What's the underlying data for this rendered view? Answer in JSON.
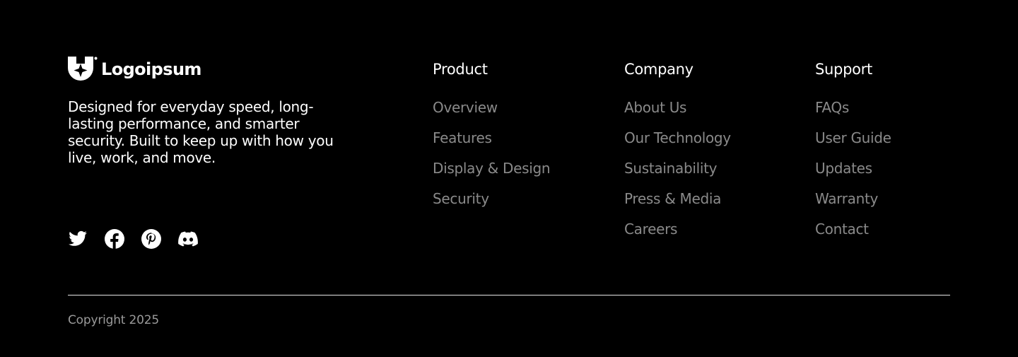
{
  "brand": {
    "name": "Logoipsum",
    "logo_icon": "logoipsum-mark-icon",
    "tagline": "Designed for everyday speed, long-lasting performance, and smarter security. Built to keep up with how you live, work, and move."
  },
  "social": [
    {
      "name": "Twitter",
      "icon": "twitter-icon"
    },
    {
      "name": "Facebook",
      "icon": "facebook-icon"
    },
    {
      "name": "Pinterest",
      "icon": "pinterest-icon"
    },
    {
      "name": "Discord",
      "icon": "discord-icon"
    }
  ],
  "columns": {
    "product": {
      "title": "Product",
      "links": [
        "Overview",
        "Features",
        "Display & Design",
        "Security"
      ]
    },
    "company": {
      "title": "Company",
      "links": [
        "About Us",
        "Our Technology",
        "Sustainability",
        "Press & Media",
        "Careers"
      ]
    },
    "support": {
      "title": "Support",
      "links": [
        "FAQs",
        "User Guide",
        "Updates",
        "Warranty",
        "Contact"
      ]
    }
  },
  "copyright": "Copyright 2025",
  "colors": {
    "background": "#000000",
    "heading": "#ffffff",
    "link": "#8a8a8a",
    "divider": "#e6e6e6"
  }
}
